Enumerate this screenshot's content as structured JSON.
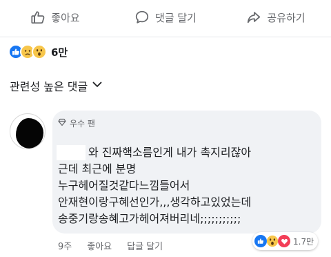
{
  "actions": {
    "like_label": "좋아요",
    "comment_label": "댓글 달기",
    "share_label": "공유하기"
  },
  "reactions": {
    "icons": [
      "like-icon",
      "sad-icon",
      "wow-icon"
    ],
    "count": "6만"
  },
  "sort": {
    "label": "관련성 높은 댓글"
  },
  "comment": {
    "badge": "우수 팬",
    "lines": [
      "와 진짜핵소름인게 내가 촉지리잖아",
      "근데 최근에 분명",
      "누구헤어질것같다느낌들어서",
      "안재현이랑구혜선인가,,,생각하고있었는데",
      "송중기랑송혜고가헤어져버리네;;;;;;;;;;;"
    ],
    "time": "9주",
    "like_label": "좋아요",
    "reply_label": "답글 달기",
    "reaction_icons": [
      "like-icon",
      "wow-icon",
      "love-icon"
    ],
    "reaction_count": "1.7만"
  },
  "colors": {
    "like_blue": "#1877f2",
    "love_red": "#f33e58",
    "reaction_yellow": "#f7c64b",
    "muted_text": "#65676b",
    "bubble_bg": "#f0f2f5"
  }
}
